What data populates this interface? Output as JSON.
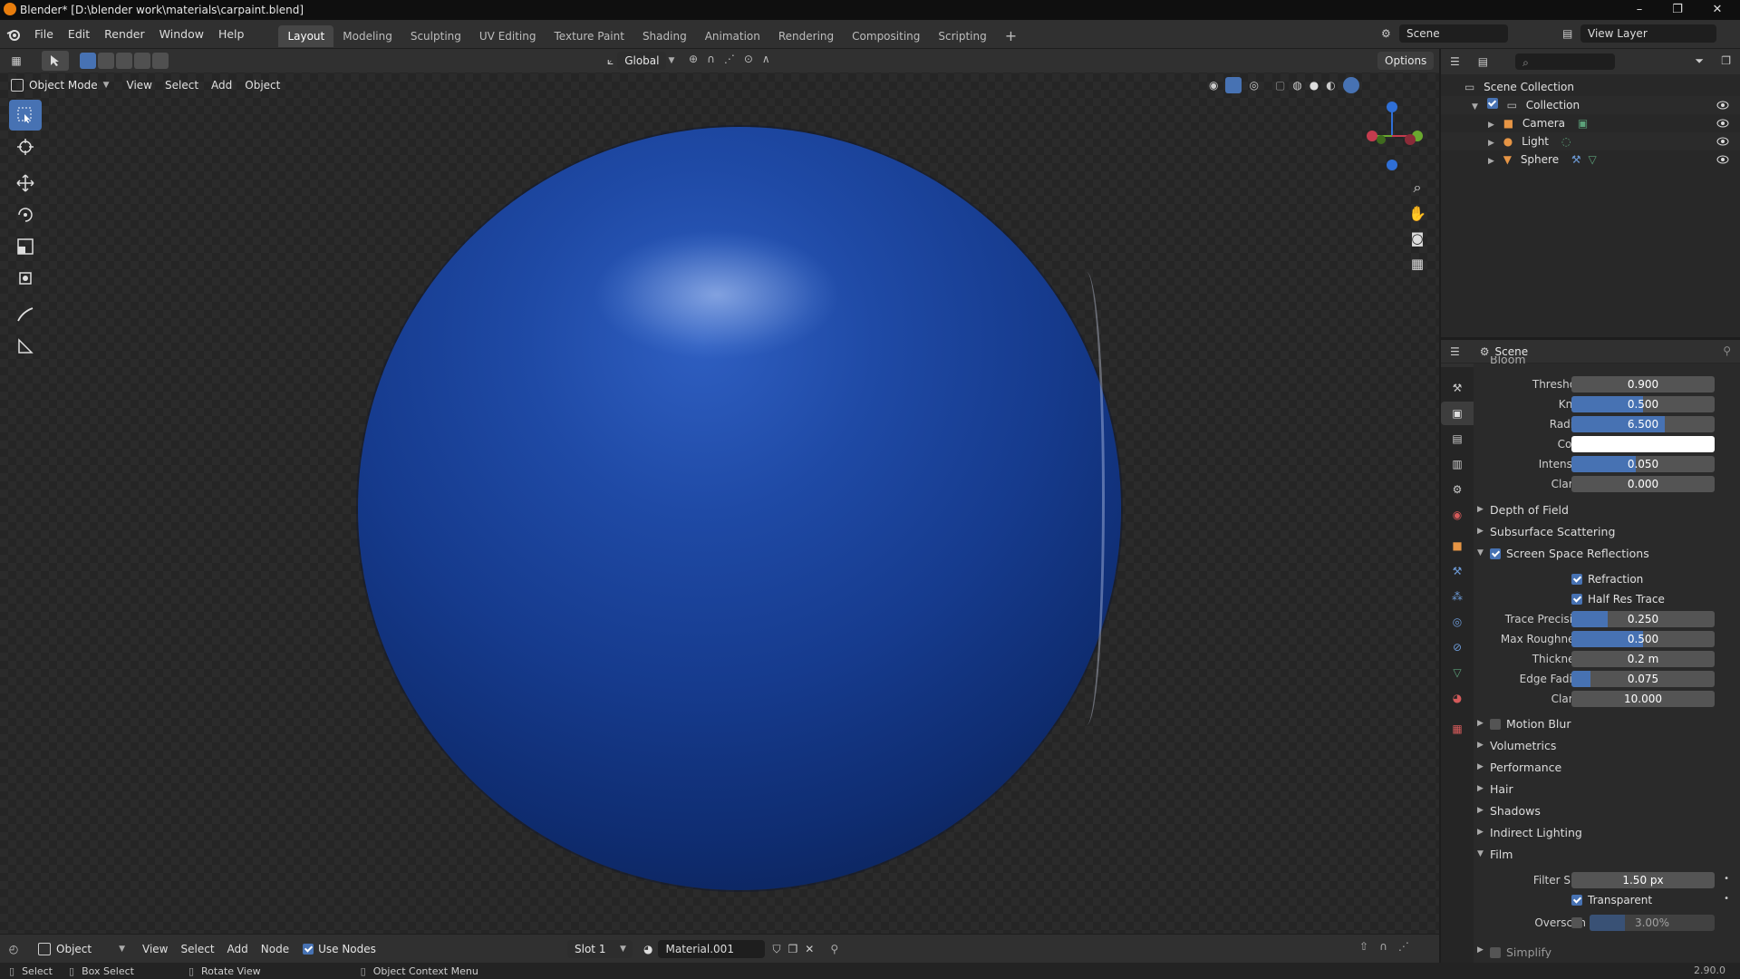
{
  "window": {
    "title": "Blender* [D:\\blender work\\materials\\carpaint.blend]",
    "minimize": "–",
    "maximize": "❐",
    "close": "✕"
  },
  "menu": [
    "File",
    "Edit",
    "Render",
    "Window",
    "Help"
  ],
  "workspaces": [
    "Layout",
    "Modeling",
    "Sculpting",
    "UV Editing",
    "Texture Paint",
    "Shading",
    "Animation",
    "Rendering",
    "Compositing",
    "Scripting",
    "+"
  ],
  "active_workspace": "Layout",
  "scene_field": "Scene",
  "view_layer_field": "View Layer",
  "tool_header": {
    "orientation": "Global",
    "options_label": "Options"
  },
  "viewport_header": {
    "mode": "Object Mode",
    "menus": [
      "View",
      "Select",
      "Add",
      "Object"
    ]
  },
  "outliner": {
    "root": "Scene Collection",
    "items": [
      {
        "label": "Collection"
      },
      {
        "label": "Camera"
      },
      {
        "label": "Light"
      },
      {
        "label": "Sphere"
      }
    ]
  },
  "properties": {
    "context": "Scene",
    "cut_panel": "Bloom",
    "bloom": [
      {
        "label": "Threshold",
        "value": "0.900",
        "fill": 0.0
      },
      {
        "label": "Knee",
        "value": "0.500",
        "fill": 0.5
      },
      {
        "label": "Radius",
        "value": "6.500",
        "fill": 0.65
      },
      {
        "label": "Color",
        "value": "",
        "fill": 0.0
      },
      {
        "label": "Intensity",
        "value": "0.050",
        "fill": 0.45
      },
      {
        "label": "Clamp",
        "value": "0.000",
        "fill": 0.0
      }
    ],
    "panels_a": [
      "Depth of Field",
      "Subsurface Scattering"
    ],
    "ssr": {
      "label": "Screen Space Reflections",
      "refraction": "Refraction",
      "half_res": "Half Res Trace",
      "fields": [
        {
          "label": "Trace Precision",
          "value": "0.250",
          "fill": 0.25
        },
        {
          "label": "Max Roughness",
          "value": "0.500",
          "fill": 0.5
        },
        {
          "label": "Thickness",
          "value": "0.2 m",
          "fill": 0.0
        },
        {
          "label": "Edge Fading",
          "value": "0.075",
          "fill": 0.13
        },
        {
          "label": "Clamp",
          "value": "10.000",
          "fill": 0.0
        }
      ]
    },
    "motion_blur": "Motion Blur",
    "panels_b": [
      "Volumetrics",
      "Performance",
      "Hair",
      "Shadows",
      "Indirect Lighting"
    ],
    "film": {
      "label": "Film",
      "filter_size_label": "Filter Size",
      "filter_size": "1.50 px",
      "transparent": "Transparent",
      "overscan_label": "Overscan",
      "overscan": "3.00%"
    },
    "simplify": "Simplify"
  },
  "footer": {
    "editor": "Object",
    "menus": [
      "View",
      "Select",
      "Add",
      "Node"
    ],
    "use_nodes": "Use Nodes",
    "slot": "Slot 1",
    "material": "Material.001"
  },
  "status": {
    "select": "Select",
    "box_select": "Box Select",
    "rotate": "Rotate View",
    "context_menu": "Object Context Menu",
    "version": "2.90.0"
  },
  "colors": {
    "accent": "#4772b3",
    "sphere": "#1f4aa6"
  }
}
